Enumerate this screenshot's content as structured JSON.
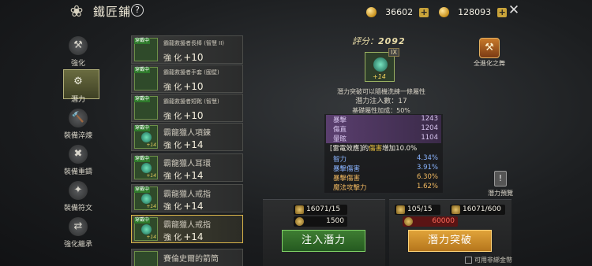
{
  "header": {
    "title": "鐵匠鋪",
    "currency1": "36602",
    "currency2": "128093"
  },
  "nav": {
    "items": [
      {
        "label": "強化",
        "icon": "anvil-icon"
      },
      {
        "label": "潛力",
        "icon": "gear-icon"
      },
      {
        "label": "裝備淬煉",
        "icon": "hammer-icon"
      },
      {
        "label": "裝備重鑄",
        "icon": "crossed-tools-icon"
      },
      {
        "label": "裝備符文",
        "icon": "rune-flame-icon"
      },
      {
        "label": "強化繼承",
        "icon": "inherit-icon"
      }
    ]
  },
  "equip_list": [
    {
      "name": "霸龍救援者長棒 (智慧 II)",
      "enh_label": "強 化",
      "enh": "+10",
      "badge": "穿戴中"
    },
    {
      "name": "霸龍救援者手套 (國壁)",
      "enh_label": "強 化",
      "enh": "+10",
      "badge": "穿戴中"
    },
    {
      "name": "霸龍救援者短靴 (智慧)",
      "enh_label": "強 化",
      "enh": "+10",
      "badge": "穿戴中"
    },
    {
      "name": "霸龍獵人項鍊",
      "enh_label": "強 化",
      "enh": "+14",
      "badge": "穿戴中",
      "level": "+14"
    },
    {
      "name": "霸龍獵人耳環",
      "enh_label": "強 化",
      "enh": "+14",
      "badge": "穿戴中",
      "level": "+14"
    },
    {
      "name": "霸龍獵人戒指",
      "enh_label": "強 化",
      "enh": "+14",
      "badge": "穿戴中",
      "level": "+14"
    },
    {
      "name": "霸龍獵人戒指",
      "enh_label": "強 化",
      "enh": "+14",
      "badge": "穿戴中",
      "level": "+14"
    },
    {
      "name": "賽倫史爾的箭筒",
      "enh_label": "",
      "enh": "",
      "badge": ""
    }
  ],
  "detail": {
    "score_label": "評分：",
    "score": "2092",
    "tag": "IX",
    "level": "+14",
    "line1": "潛力突破可以隨機洗練一條屬性",
    "line2": "潛力注入數：17",
    "line3": "基礎屬性加成：50%"
  },
  "stats": [
    {
      "k": "暴擊",
      "v": "1243",
      "style": "purple"
    },
    {
      "k": "傷直",
      "v": "1204",
      "style": "purple"
    },
    {
      "k": "暈眩",
      "v": "1104",
      "style": "purple"
    },
    {
      "k": "[雷電效應]的",
      "hl": "傷害",
      "tail": "增加10.0%",
      "v": "",
      "style": "white"
    },
    {
      "k": "智力",
      "v": "4.34%",
      "style": "blue"
    },
    {
      "k": "暴擊傷害",
      "v": "3.91%",
      "style": "blue"
    },
    {
      "k": "暴擊傷害",
      "v": "6.30%",
      "style": "orange"
    },
    {
      "k": "魔法攻擊力",
      "v": "1.62%",
      "style": "orange"
    }
  ],
  "side": {
    "full_enhance": "全進化之舞",
    "preview": "潛力預覽"
  },
  "inject": {
    "res1": "16071/15",
    "res2": "1500",
    "button": "注入潛力"
  },
  "breakthrough": {
    "res1": "105/15",
    "res2": "16071/600",
    "res3": "60000",
    "button": "潛力突破",
    "checkbox_label": "可用非綁金幣"
  }
}
